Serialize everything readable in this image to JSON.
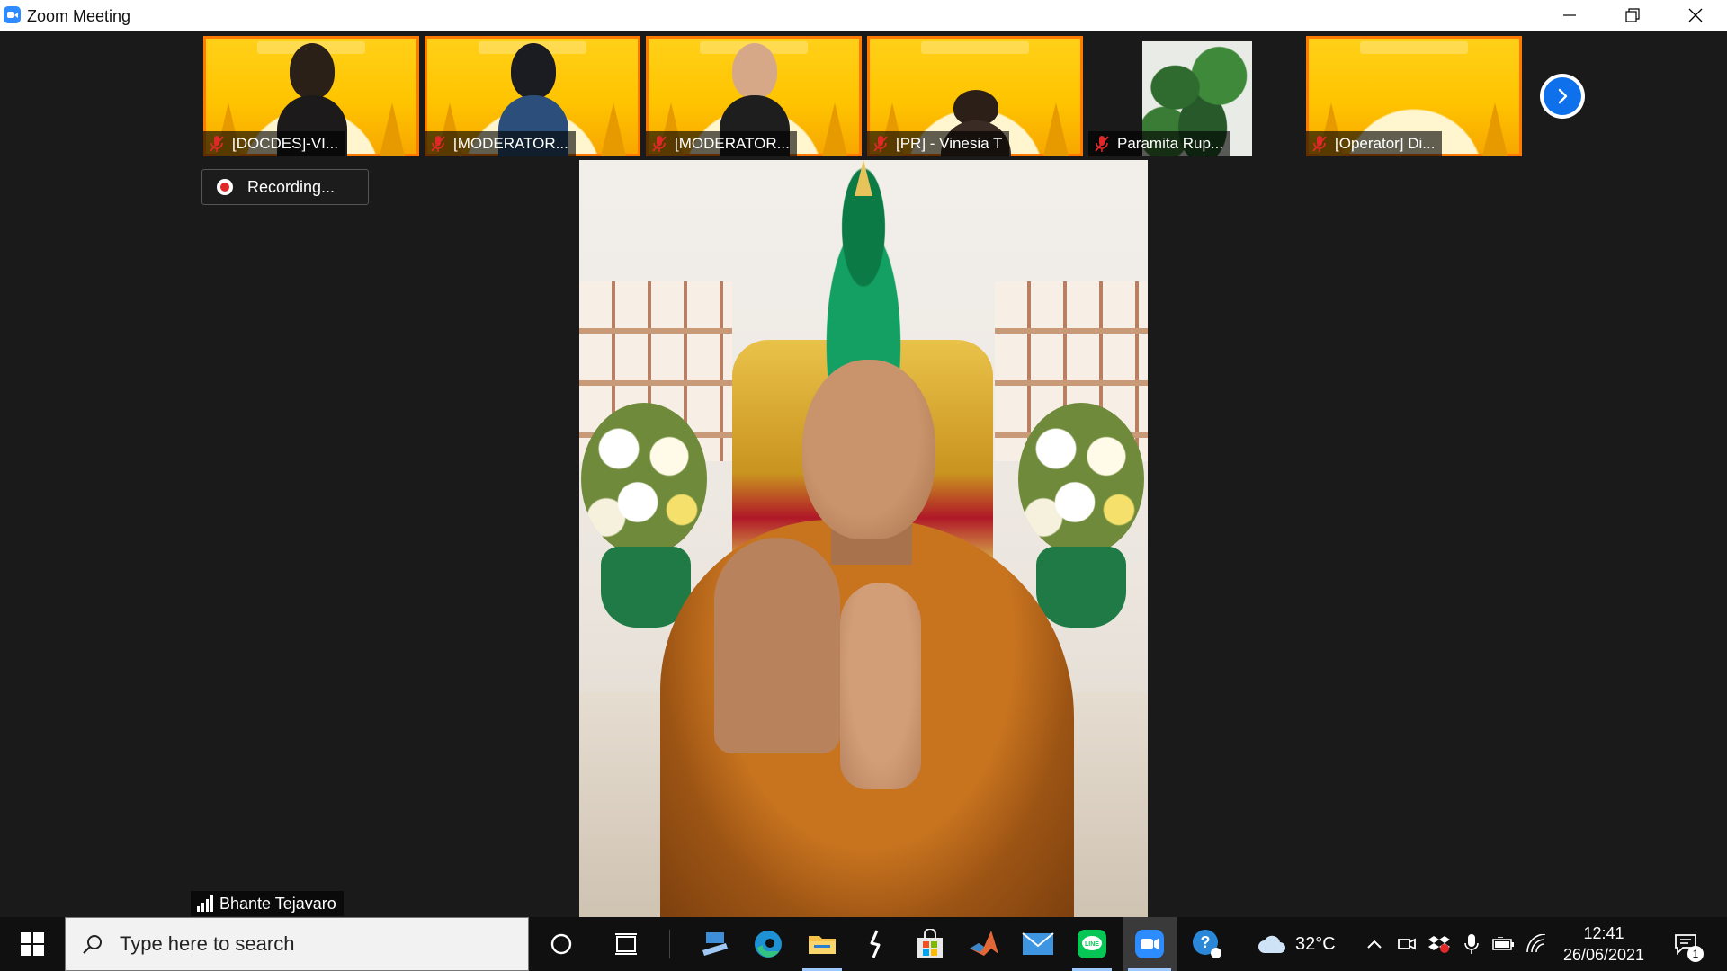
{
  "window": {
    "title": "Zoom Meeting"
  },
  "thumbnails": [
    {
      "name": "[DOCDES]-VI...",
      "muted": true,
      "background": "yellow"
    },
    {
      "name": "[MODERATOR...",
      "muted": true,
      "background": "yellow"
    },
    {
      "name": "[MODERATOR...",
      "muted": true,
      "background": "yellow"
    },
    {
      "name": "[PR] - Vinesia T",
      "muted": true,
      "background": "yellow"
    },
    {
      "name": "Paramita Rup...",
      "muted": true,
      "background": "plant"
    },
    {
      "name": "[Operator] Di...",
      "muted": true,
      "background": "yellow"
    }
  ],
  "recording": {
    "label": "Recording..."
  },
  "speaker": {
    "name": "Bhante Tejavaro"
  },
  "taskbar": {
    "search_placeholder": "Type here to search",
    "apps": [
      "cortana-icon",
      "task-view-icon",
      "pc-icon",
      "edge-icon",
      "file-explorer-icon",
      "pen-icon",
      "store-icon",
      "matlab-icon",
      "mail-icon",
      "line-icon",
      "zoom-icon",
      "help-icon"
    ],
    "weather": {
      "temperature": "32°C"
    },
    "clock": {
      "time": "12:41",
      "date": "26/06/2021"
    },
    "notifications": {
      "count": "1"
    }
  },
  "colors": {
    "zoom_blue": "#2D8CFF",
    "thumb_border": "#ff7a00",
    "muted_red": "#e02828",
    "meeting_bg": "#1a1a1a"
  }
}
